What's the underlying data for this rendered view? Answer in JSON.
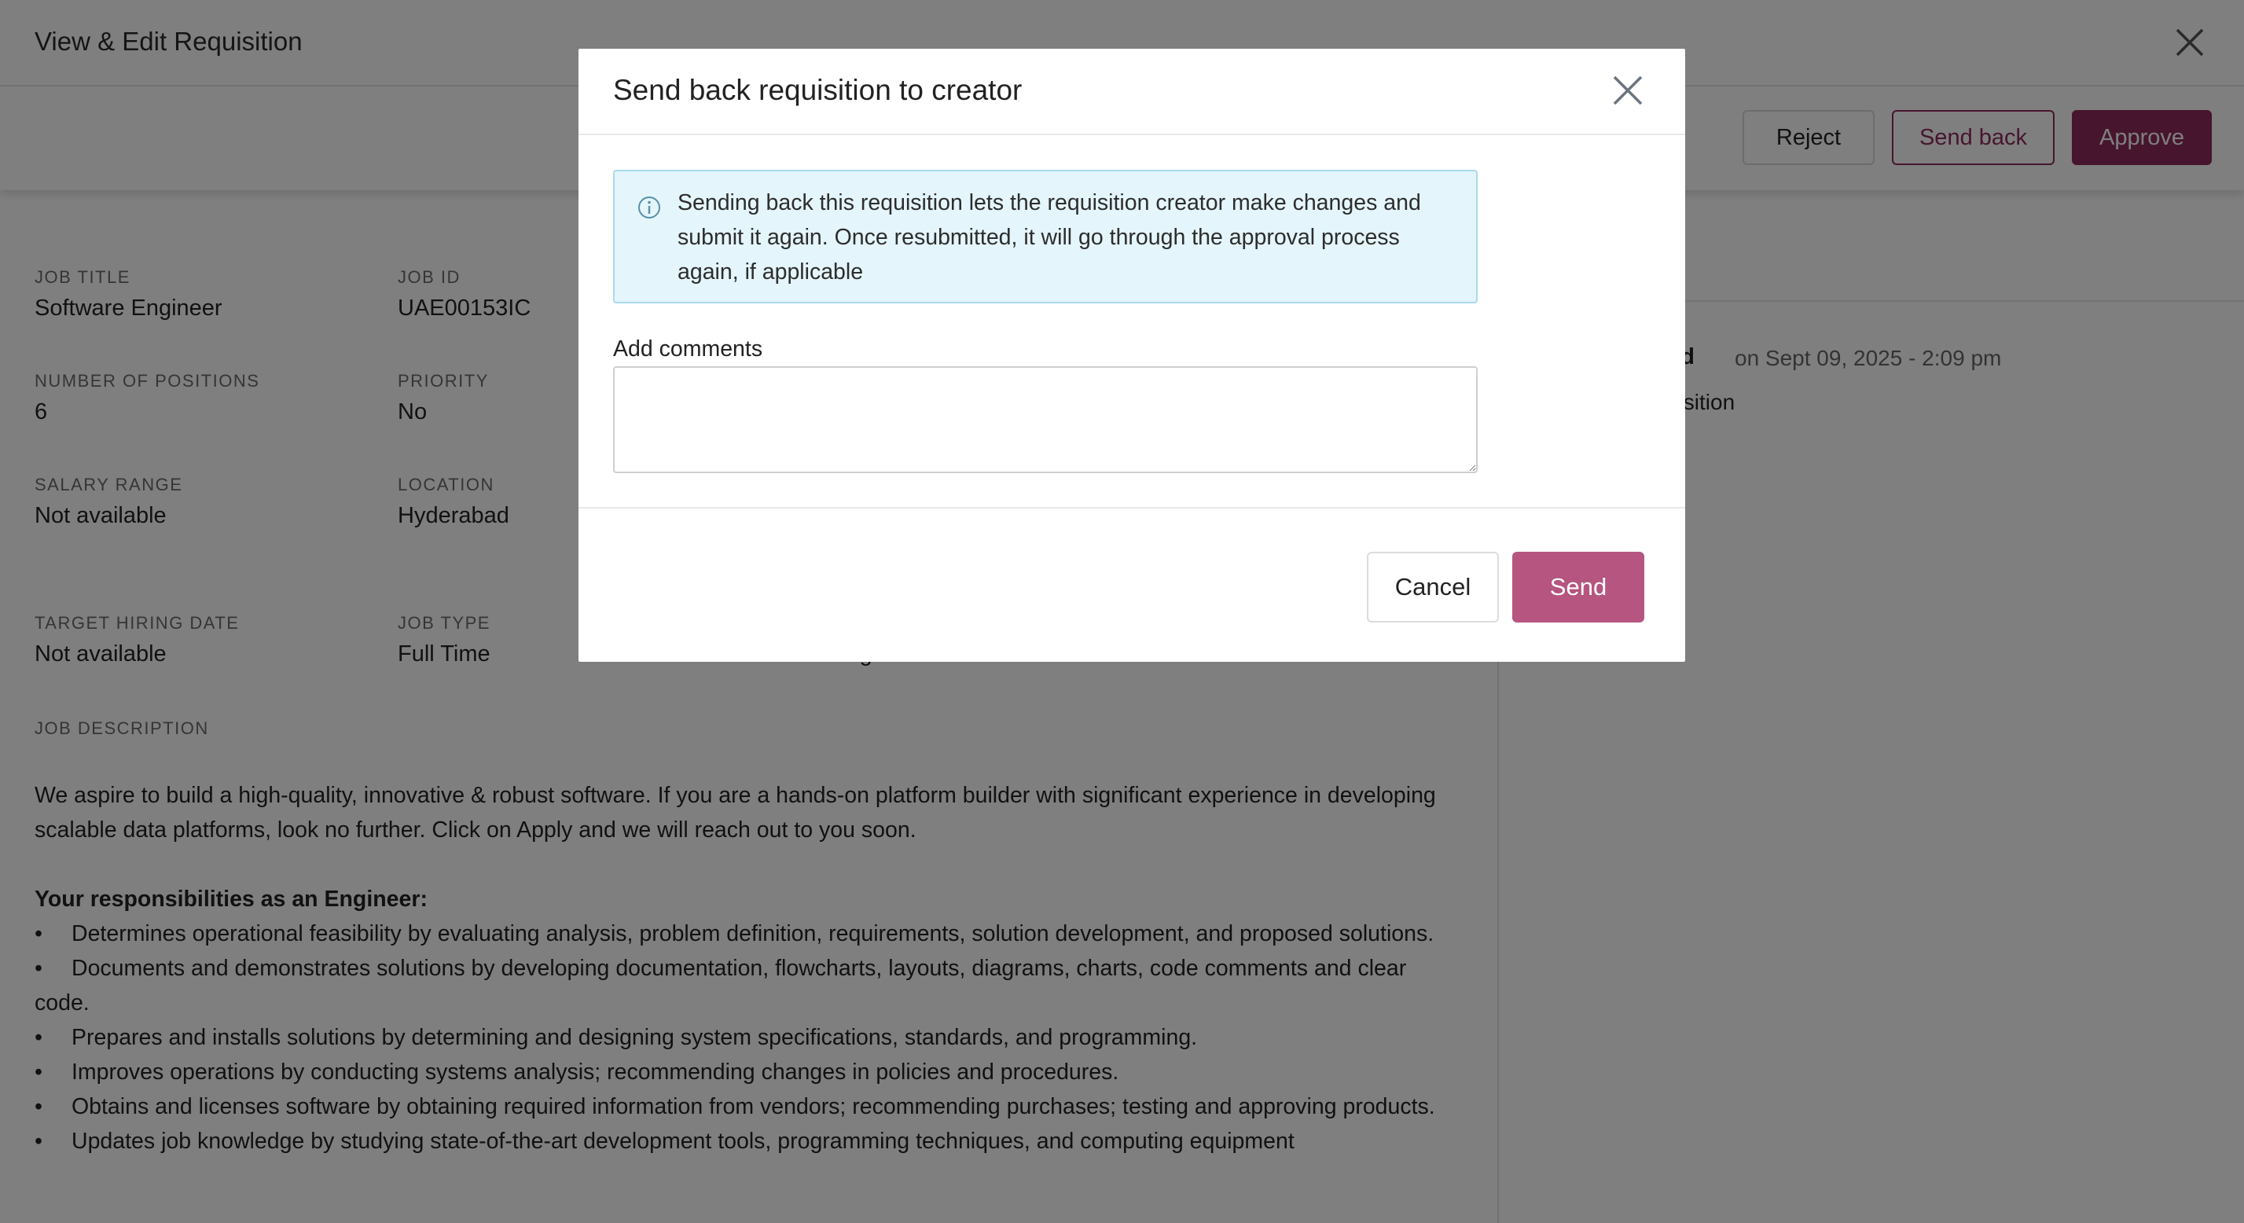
{
  "page": {
    "title": "View & Edit Requisition",
    "actions": {
      "reject": "Reject",
      "send_back": "Send back",
      "approve": "Approve"
    }
  },
  "fields": {
    "job_title": {
      "label": "JOB TITLE",
      "value": "Software Engineer"
    },
    "job_id": {
      "label": "JOB ID",
      "value": "UAE00153IC"
    },
    "number_of_positions": {
      "label": "NUMBER OF POSITIONS",
      "value": "6"
    },
    "priority": {
      "label": "PRIORITY",
      "value": "No"
    },
    "salary_range": {
      "label": "SALARY RANGE",
      "value": "Not available"
    },
    "location": {
      "label": "LOCATION",
      "value": "Hyderabad"
    },
    "target_hiring_date": {
      "label": "TARGET HIRING DATE",
      "value": "Not available"
    },
    "job_type": {
      "label": "JOB TYPE",
      "value": "Full Time"
    },
    "hiring_type_partial": {
      "value": "New Hiring"
    }
  },
  "job_description": {
    "label": "JOB DESCRIPTION",
    "intro": "We aspire to build a high-quality, innovative & robust software. If you are a hands-on platform builder with significant experience in developing scalable data platforms, look no further. Click on Apply and we will reach out to you soon.",
    "responsibilities_heading": "Your responsibilities as an Engineer:",
    "bullets": [
      "Determines operational feasibility by evaluating analysis, problem definition, requirements, solution development, and proposed solutions.",
      "Documents and demonstrates solutions by developing documentation, flowcharts, layouts, diagrams, charts, code comments and clear code.",
      "Prepares and installs solutions by determining and designing system specifications, standards, and programming.",
      "Improves operations by conducting systems analysis; recommending changes in policies and procedures.",
      "Obtains and licenses software by obtaining required information from vendors; recommending purchases; testing and approving products.",
      "Updates job knowledge by studying state-of-the-art development tools, programming techniques, and computing equipment"
    ]
  },
  "activity": {
    "author_partial": "ield",
    "time": "on Sept 09, 2025 - 2:09 pm",
    "text_partial": "uisition"
  },
  "modal": {
    "title": "Send back requisition to creator",
    "info": "Sending back this requisition lets the requisition creator make changes and submit it again. Once resubmitted, it will go through the approval process again, if applicable",
    "comments_label": "Add comments",
    "comments_value": "",
    "cancel": "Cancel",
    "send": "Send"
  },
  "colors": {
    "brand": "#8e2b5c",
    "send_button": "#b55580",
    "info_bg": "#e4f5fb",
    "info_border": "#a8dbee"
  },
  "icons": {
    "close": "close-icon",
    "info": "info-icon"
  }
}
